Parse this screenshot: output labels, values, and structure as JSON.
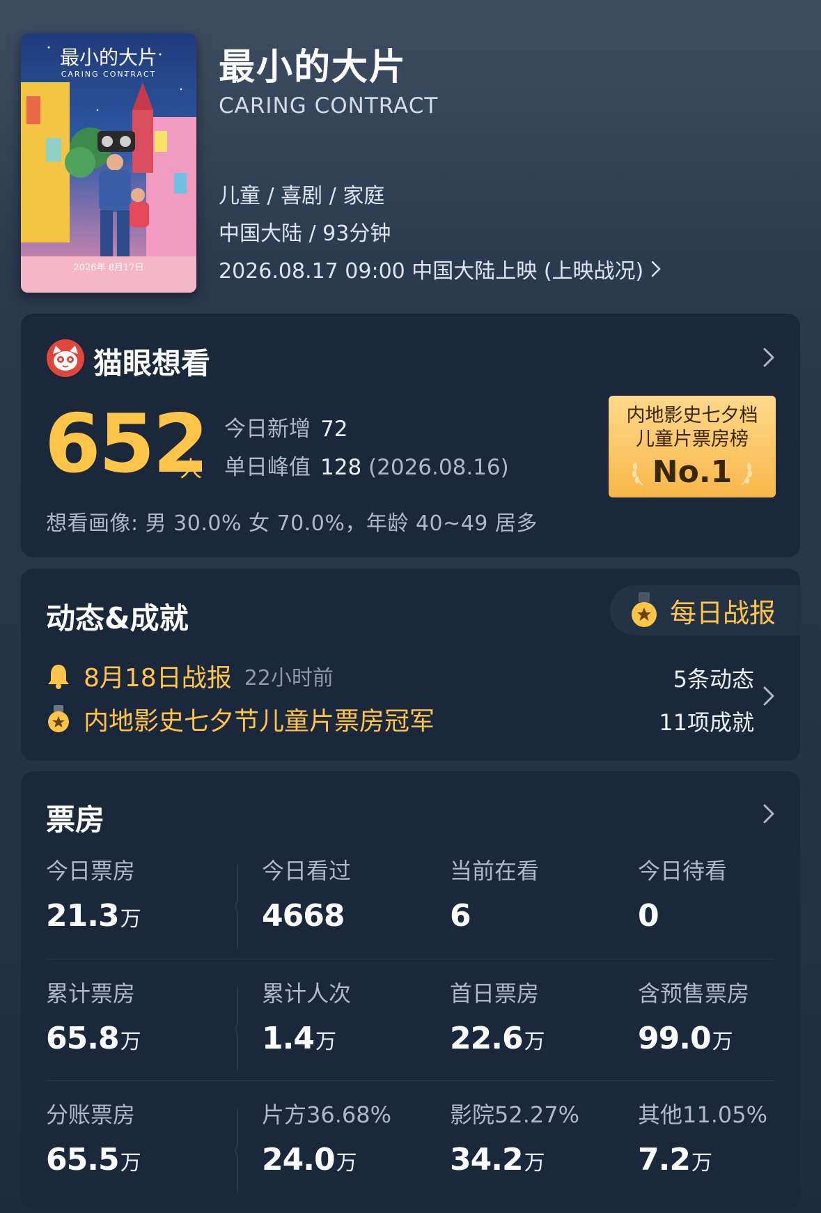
{
  "movie": {
    "title": "最小的大片",
    "subtitle": "CARING CONTRACT",
    "genres": "儿童 / 喜剧 / 家庭",
    "region_runtime": "中国大陆 / 93分钟",
    "release": "2026.08.17 09:00 中国大陆上映 (上映战况)",
    "poster": {
      "title": "最小的大片",
      "subtitle": "CARING CONTRACT",
      "date": "2026年 8月17日"
    }
  },
  "want": {
    "title": "猫眼想看",
    "count": "652",
    "unit": "人",
    "today_label": "今日新增",
    "today_value": "72",
    "peak_label": "单日峰值",
    "peak_value": "128",
    "peak_date": "(2026.08.16)",
    "portrait": "想看画像: 男 30.0%  女 70.0%，年龄 40~49 居多",
    "rank_line1": "内地影史七夕档",
    "rank_line2": "儿童片票房榜",
    "rank_no": "No.1"
  },
  "news": {
    "title": "动态&成就",
    "daily_label": "每日战报",
    "report_title": "8月18日战报",
    "report_time": "22小时前",
    "achievement": "内地影史七夕节儿童片票房冠军",
    "dynamics_count": "5条动态",
    "achievements_count": "11项成就"
  },
  "box_office": {
    "title": "票房",
    "rows": [
      [
        {
          "label": "今日票房",
          "value": "21.3",
          "unit": "万"
        },
        {
          "label": "今日看过",
          "value": "4668",
          "unit": ""
        },
        {
          "label": "当前在看",
          "value": "6",
          "unit": ""
        },
        {
          "label": "今日待看",
          "value": "0",
          "unit": ""
        }
      ],
      [
        {
          "label": "累计票房",
          "value": "65.8",
          "unit": "万"
        },
        {
          "label": "累计人次",
          "value": "1.4",
          "unit": "万"
        },
        {
          "label": "首日票房",
          "value": "22.6",
          "unit": "万"
        },
        {
          "label": "含预售票房",
          "value": "99.0",
          "unit": "万"
        }
      ],
      [
        {
          "label": "分账票房",
          "value": "65.5",
          "unit": "万"
        },
        {
          "label": "片方36.68%",
          "value": "24.0",
          "unit": "万"
        },
        {
          "label": "影院52.27%",
          "value": "34.2",
          "unit": "万"
        },
        {
          "label": "其他11.05%",
          "value": "7.2",
          "unit": "万"
        }
      ]
    ]
  },
  "colors": {
    "accent_gold": "#ffc548",
    "card_bg": "#1b273a",
    "muted_text": "#aeb8c7"
  }
}
